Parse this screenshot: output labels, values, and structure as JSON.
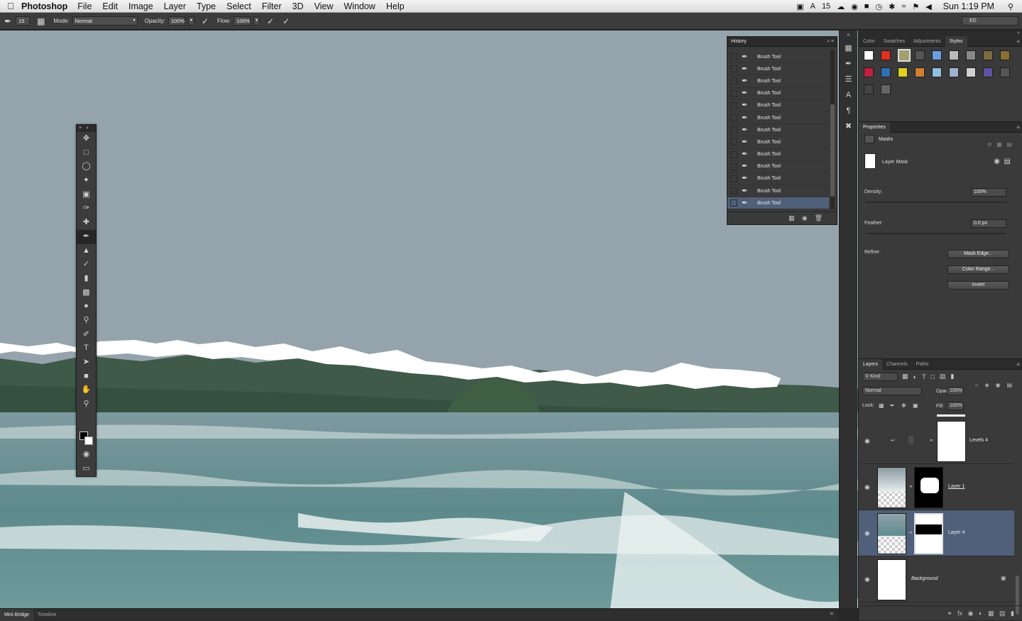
{
  "menubar": {
    "app_name": "Photoshop",
    "menus": [
      "File",
      "Edit",
      "Image",
      "Layer",
      "Type",
      "Select",
      "Filter",
      "3D",
      "View",
      "Window",
      "Help"
    ],
    "status_text": "15",
    "clock": "Sun 1:19 PM"
  },
  "options": {
    "brush_size": "15",
    "mode_label": "Mode:",
    "mode_value": "Normal",
    "opacity_label": "Opacity:",
    "opacity_value": "100%",
    "flow_label": "Flow:",
    "flow_value": "100%",
    "workspace": "ED"
  },
  "history": {
    "title": "History",
    "items": [
      "Brush Tool",
      "Brush Tool",
      "Brush Tool",
      "Brush Tool",
      "Brush Tool",
      "Brush Tool",
      "Brush Tool",
      "Brush Tool",
      "Brush Tool",
      "Brush Tool",
      "Brush Tool",
      "Brush Tool",
      "Brush Tool"
    ]
  },
  "styles_panel": {
    "tabs": [
      "Color",
      "Swatches",
      "Adjustments",
      "Styles"
    ],
    "active_tab": "Styles"
  },
  "properties": {
    "title": "Properties",
    "section": "Masks",
    "mask_label": "Layer Mask",
    "density_label": "Density:",
    "density_value": "100%",
    "feather_label": "Feather:",
    "feather_value": "0.0 px",
    "refine_label": "Refine:",
    "btn_mask_edge": "Mask Edge...",
    "btn_color_range": "Color Range...",
    "btn_invert": "Invert"
  },
  "layers_panel": {
    "tabs": [
      "Layers",
      "Channels",
      "Paths"
    ],
    "kind_label": "Kind",
    "blend_mode": "Normal",
    "opacity_label": "Opacity:",
    "opacity_value": "100%",
    "lock_label": "Lock:",
    "fill_label": "Fill:",
    "fill_value": "100%",
    "layers": [
      {
        "name": "Levels 4"
      },
      {
        "name": "Layer 1"
      },
      {
        "name": "Layer 4"
      },
      {
        "name": "Background"
      }
    ]
  },
  "bottom_tabs": [
    "Mini Bridge",
    "Timeline"
  ],
  "colors": {
    "selection": "#50607a",
    "panel": "#3a3a3a"
  }
}
